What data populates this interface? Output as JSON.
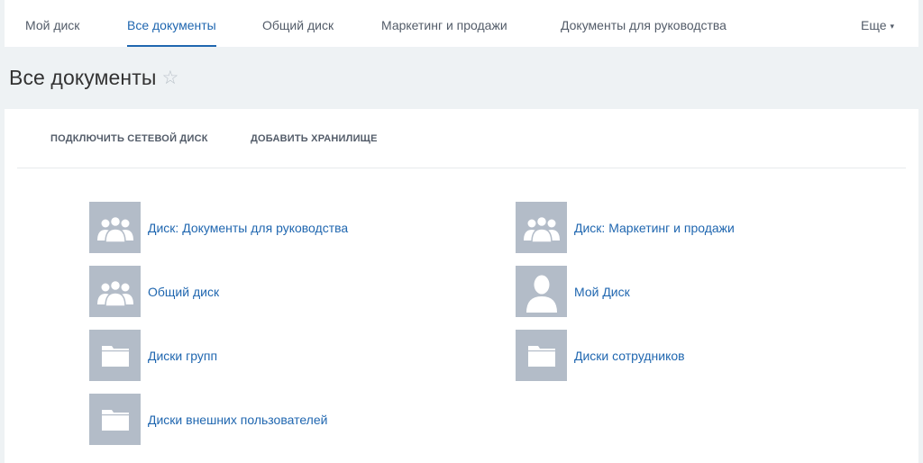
{
  "topnav": {
    "tabs": [
      {
        "label": "Мой диск",
        "active": false
      },
      {
        "label": "Все документы",
        "active": true
      },
      {
        "label": "Общий диск",
        "active": false
      },
      {
        "label": "Маркетинг и продажи",
        "active": false
      },
      {
        "label": "Документы для руководства",
        "active": false
      }
    ],
    "more_label": "Еще"
  },
  "header": {
    "title": "Все документы",
    "favorite_icon": "star-outline-icon"
  },
  "actions": [
    {
      "label": "ПОДКЛЮЧИТЬ СЕТЕВОЙ ДИСК"
    },
    {
      "label": "ДОБАВИТЬ ХРАНИЛИЩЕ"
    }
  ],
  "disks": [
    {
      "label": "Диск: Документы для руководства",
      "icon": "group-icon"
    },
    {
      "label": "Диск: Маркетинг и продажи",
      "icon": "group-icon"
    },
    {
      "label": "Общий диск",
      "icon": "group-icon"
    },
    {
      "label": "Мой Диск",
      "icon": "user-icon"
    },
    {
      "label": "Диски групп",
      "icon": "folder-icon"
    },
    {
      "label": "Диски сотрудников",
      "icon": "folder-icon"
    },
    {
      "label": "Диски внешних пользователей",
      "icon": "folder-icon"
    }
  ],
  "colors": {
    "link": "#2067b0",
    "icon_tile": "#b3bcc8",
    "background": "#eef2f4"
  }
}
